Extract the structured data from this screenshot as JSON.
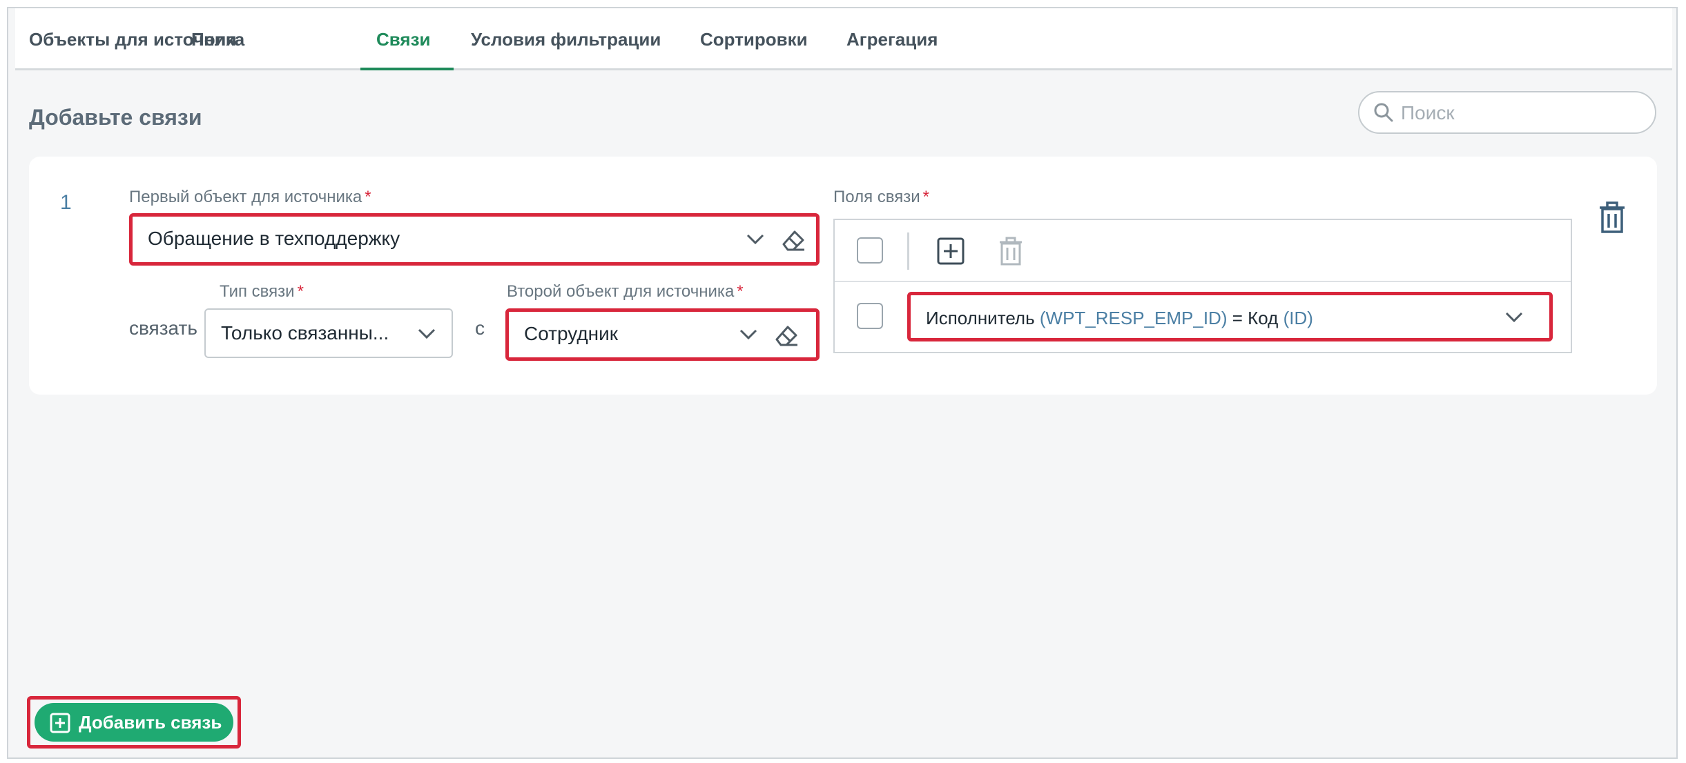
{
  "tabs": [
    {
      "label": "Объекты для источника"
    },
    {
      "label": "Поля"
    },
    {
      "label": "Связи"
    },
    {
      "label": "Условия фильтрации"
    },
    {
      "label": "Сортировки"
    },
    {
      "label": "Агрегация"
    }
  ],
  "active_tab": "Связи",
  "accent_color": "#1e8a5a",
  "highlight_color": "#d8263b",
  "page": {
    "heading": "Добавьте связи",
    "search_placeholder": "Поиск"
  },
  "link": {
    "number": "1",
    "first_object_label": "Первый объект для источника",
    "first_object_value": "Обращение в техподдержку",
    "link_word": "связать",
    "link_type_label": "Тип связи",
    "link_type_value": "Только связанны...",
    "with_word": "с",
    "second_object_label": "Второй объект для источника",
    "second_object_value": "Сотрудник",
    "required_mark": "*",
    "relation_fields_label": "Поля связи",
    "relation": {
      "left_field": "Исполнитель",
      "left_code": "(WPT_RESP_EMP_ID)",
      "operator": "=",
      "right_field": "Код",
      "right_code": "(ID)"
    }
  },
  "add_button_label": "Добавить связь",
  "icons": [
    "search-icon",
    "chevron-down-icon",
    "eraser-icon",
    "add-square-icon",
    "trash-icon"
  ]
}
